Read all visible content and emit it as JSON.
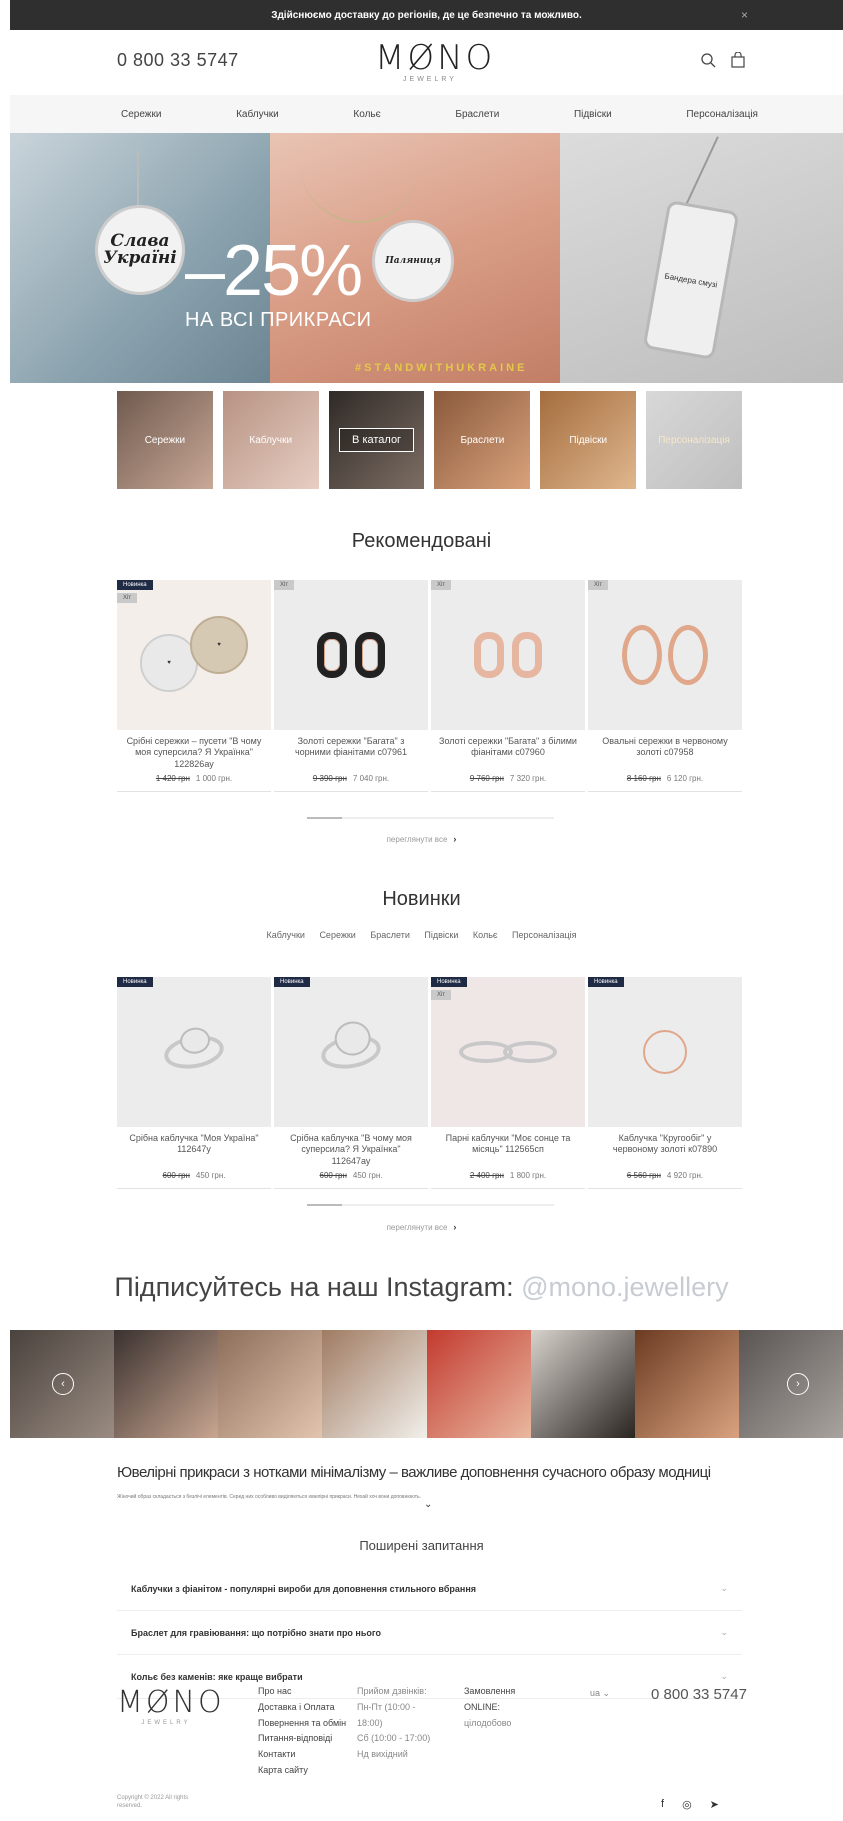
{
  "topbar": {
    "message": "Здійснюємо доставку до регіонів, де це безпечно та можливо.",
    "close": "×"
  },
  "header": {
    "phone": "0 800 33 5747",
    "logo": "MØNO",
    "logo_sub": "JEWELRY",
    "icons": [
      "search-icon",
      "bag-icon"
    ]
  },
  "nav": [
    "Сережки",
    "Каблучки",
    "Кольє",
    "Браслети",
    "Підвіски",
    "Персоналізація"
  ],
  "hero": {
    "discount": "–25%",
    "subtitle": "НА ВСІ ПРИКРАСИ",
    "tag": "#STANDWITHUKRAINE",
    "pendant1": "Слава Україні",
    "pendant2": "Паляниця",
    "pendant3": "Бандера смузі"
  },
  "categories": [
    {
      "label": "Сережки"
    },
    {
      "label": "Каблучки"
    },
    {
      "label": "В каталог"
    },
    {
      "label": "Браслети"
    },
    {
      "label": "Підвіски"
    },
    {
      "label": "Персоналізація"
    }
  ],
  "recommended": {
    "title": "Рекомендовані",
    "products": [
      {
        "badge": "Новинка",
        "badge2": "Хіт",
        "name": "Срібні сережки – пусети \"В чому моя суперсила? Я Українка\" 122826ау",
        "old": "1 420 грн",
        "price": "1 000 грн."
      },
      {
        "badge": "Хіт",
        "name": "Золоті сережки \"Багата\" з чорними фіанітами с07961",
        "old": "9 390 грн",
        "price": "7 040 грн."
      },
      {
        "badge": "Хіт",
        "name": "Золоті сережки \"Багата\" з білими фіанітами с07960",
        "old": "9 760 грн",
        "price": "7 320 грн."
      },
      {
        "badge": "Хіт",
        "name": "Овальні сережки в червоному золоті с07958",
        "old": "8 160 грн",
        "price": "6 120 грн."
      }
    ],
    "view_all": "переглянути все"
  },
  "new": {
    "title": "Новинки",
    "filters": [
      "Каблучки",
      "Сережки",
      "Браслети",
      "Підвіски",
      "Кольє",
      "Персоналізація"
    ],
    "products": [
      {
        "badge": "Новинка",
        "name": "Срібна каблучка \"Моя Україна\" 112647у",
        "old": "600 грн",
        "price": "450 грн."
      },
      {
        "badge": "Новинка",
        "name": "Срібна каблучка \"В чому моя суперсила? Я Українка\" 112647ау",
        "old": "600 грн",
        "price": "450 грн."
      },
      {
        "badge": "Новинка",
        "badge2": "Хіт",
        "name": "Парні каблучки \"Моє сонце та місяць\" 112565сп",
        "old": "2 400 грн",
        "price": "1 800 грн."
      },
      {
        "badge": "Новинка",
        "name": "Каблучка \"Кругообіг\" у червоному золоті к07890",
        "old": "6 560 грн",
        "price": "4 920 грн."
      }
    ],
    "view_all": "переглянути все"
  },
  "instagram": {
    "title": "Підписуйтесь на наш Instagram:",
    "handle": "@mono.jewellery",
    "prev": "‹",
    "next": "›"
  },
  "seo": {
    "title": "Ювелірні прикраси з нотками мінімалізму – важливе доповнення сучасного образу модниці",
    "text": "Жіночий образ складається з безлічі елементів. Серед них особливо виділяються ювелірні прикраси. Нехай хоч вони доповнюють."
  },
  "faq": {
    "title": "Поширені запитання",
    "items": [
      "Каблучки з фіанітом - популярні вироби для доповнення стильного вбрання",
      "Браслет для гравіювання: що потрібно знати про нього",
      "Кольє без каменів: яке краще вибрати"
    ]
  },
  "footer": {
    "logo": "MØNO",
    "logo_sub": "JEWELRY",
    "copyright": "Copyright © 2022 All rights reserved.",
    "col1": [
      "Про нас",
      "Доставка і Оплата",
      "Повернення та обмін",
      "Питання-відповіді",
      "Контакти",
      "Карта сайту"
    ],
    "col2": [
      "Прийом дзвінків:",
      "Пн-Пт (10:00 -",
      "18:00)",
      "Сб (10:00 - 17:00)",
      "Нд вихідний"
    ],
    "col3": [
      "Замовлення",
      "ONLINE:",
      "цілодобово"
    ],
    "lang": "ua ⌄",
    "phone": "0 800 33 5747",
    "social": [
      "f",
      "◎",
      "➤"
    ]
  }
}
